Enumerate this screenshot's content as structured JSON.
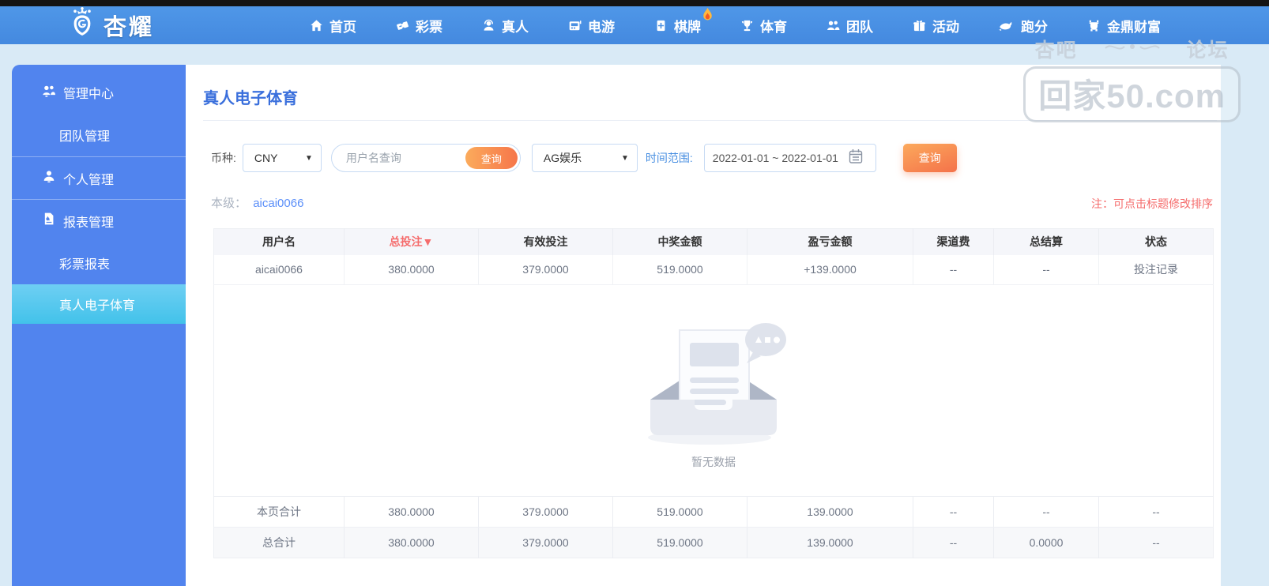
{
  "brand": {
    "name": "杏耀"
  },
  "nav": {
    "items": [
      {
        "label": "首页",
        "icon": "home-icon"
      },
      {
        "label": "彩票",
        "icon": "ticket-icon"
      },
      {
        "label": "真人",
        "icon": "live-dealer-icon"
      },
      {
        "label": "电游",
        "icon": "slot-machine-icon"
      },
      {
        "label": "棋牌",
        "icon": "cards-icon",
        "badge": "flame-icon"
      },
      {
        "label": "体育",
        "icon": "trophy-icon"
      },
      {
        "label": "团队",
        "icon": "team-icon"
      },
      {
        "label": "活动",
        "icon": "gift-icon"
      },
      {
        "label": "跑分",
        "icon": "whale-icon"
      },
      {
        "label": "金鼎财富",
        "icon": "wealth-icon"
      }
    ]
  },
  "watermark": {
    "left": "杏吧",
    "right": "论坛",
    "domain": "回家50.com"
  },
  "sidebar": {
    "items": [
      {
        "label": "管理中心",
        "icon": "management-icon"
      },
      {
        "label": "团队管理"
      },
      {
        "label": "个人管理",
        "icon": "user-icon"
      },
      {
        "label": "报表管理",
        "icon": "report-icon"
      },
      {
        "label": "彩票报表"
      },
      {
        "label": "真人电子体育",
        "active": true
      }
    ]
  },
  "page": {
    "title": "真人电子体育"
  },
  "filters": {
    "currency_label": "币种:",
    "currency_value": "CNY",
    "username_placeholder": "用户名查询",
    "inline_search_label": "查询",
    "platform_value": "AG娱乐",
    "date_label": "时间范围:",
    "date_value": "2022-01-01 ~ 2022-01-01",
    "search_label": "查询"
  },
  "level": {
    "label": "本级：",
    "value": "aicai0066"
  },
  "note": "注：可点击标题修改排序",
  "icons": {
    "chevron_down": "▼"
  },
  "table": {
    "headers": [
      "用户名",
      "总投注▼",
      "有效投注",
      "中奖金额",
      "盈亏金额",
      "渠道费",
      "总结算",
      "状态"
    ],
    "rows": [
      {
        "username": "aicai0066",
        "total_bet": "380.0000",
        "valid_bet": "379.0000",
        "win_amount": "519.0000",
        "profit": "+139.0000",
        "channel_fee": "--",
        "settlement": "--",
        "status": "投注记录"
      }
    ],
    "empty_text": "暂无数据",
    "page_total": {
      "label": "本页合计",
      "values": [
        "380.0000",
        "379.0000",
        "519.0000",
        "139.0000",
        "--",
        "--",
        "--"
      ]
    },
    "grand_total": {
      "label": "总合计",
      "values": [
        "380.0000",
        "379.0000",
        "519.0000",
        "139.0000",
        "--",
        "0.0000",
        "--"
      ]
    }
  },
  "colors": {
    "nav_blue": "#4a90e2",
    "sidebar_blue": "#5184ee",
    "active_cyan": "#42c2ea",
    "accent_orange": "#f6764a",
    "note_red": "#f56c6c",
    "profit_green": "#27a24a",
    "link_blue": "#5b8ff9",
    "page_bg": "#d9eaf6"
  }
}
